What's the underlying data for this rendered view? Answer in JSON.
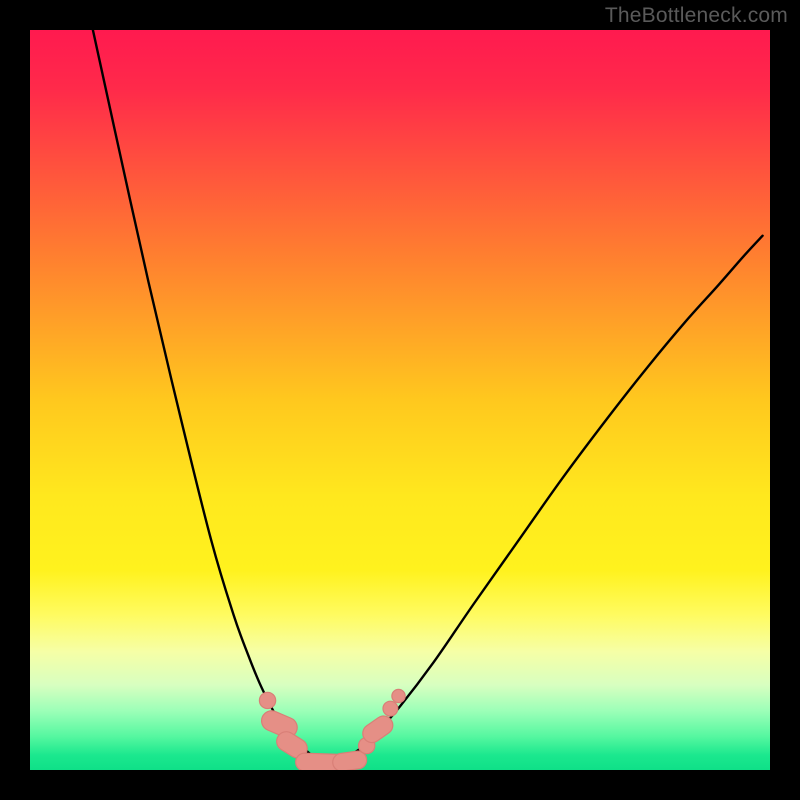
{
  "watermark": "TheBottleneck.com",
  "chart_data": {
    "type": "line",
    "title": "",
    "xlabel": "",
    "ylabel": "",
    "xlim": [
      0,
      1
    ],
    "ylim": [
      0,
      1
    ],
    "background_gradient_stops": [
      {
        "offset": 0.0,
        "color": "#ff1a4f"
      },
      {
        "offset": 0.08,
        "color": "#ff2a4a"
      },
      {
        "offset": 0.3,
        "color": "#ff7d30"
      },
      {
        "offset": 0.5,
        "color": "#ffc81e"
      },
      {
        "offset": 0.63,
        "color": "#ffe81e"
      },
      {
        "offset": 0.73,
        "color": "#fff21e"
      },
      {
        "offset": 0.79,
        "color": "#fffb60"
      },
      {
        "offset": 0.84,
        "color": "#f6ffa6"
      },
      {
        "offset": 0.885,
        "color": "#d8ffc0"
      },
      {
        "offset": 0.92,
        "color": "#9cffb8"
      },
      {
        "offset": 0.955,
        "color": "#55f7a0"
      },
      {
        "offset": 0.98,
        "color": "#1be88e"
      },
      {
        "offset": 1.0,
        "color": "#0fe088"
      }
    ],
    "series": [
      {
        "name": "left-arm",
        "x": [
          0.085,
          0.12,
          0.16,
          0.205,
          0.245,
          0.275,
          0.295,
          0.31,
          0.325,
          0.336,
          0.344,
          0.352,
          0.359,
          0.367,
          0.378,
          0.395
        ],
        "y": [
          1.0,
          0.84,
          0.66,
          0.47,
          0.31,
          0.21,
          0.155,
          0.118,
          0.087,
          0.067,
          0.055,
          0.046,
          0.039,
          0.032,
          0.022,
          0.008
        ]
      },
      {
        "name": "right-arm",
        "x": [
          0.395,
          0.42,
          0.445,
          0.47,
          0.5,
          0.545,
          0.6,
          0.66,
          0.72,
          0.78,
          0.835,
          0.885,
          0.93,
          0.965,
          0.99
        ],
        "y": [
          0.008,
          0.014,
          0.028,
          0.052,
          0.086,
          0.145,
          0.225,
          0.31,
          0.395,
          0.475,
          0.545,
          0.605,
          0.655,
          0.695,
          0.722
        ]
      }
    ],
    "markers": [
      {
        "shape": "circle",
        "cx": 0.321,
        "cy": 0.094,
        "r": 0.011
      },
      {
        "shape": "capsule",
        "cx": 0.337,
        "cy": 0.062,
        "w": 0.027,
        "h": 0.05,
        "angle": -67
      },
      {
        "shape": "capsule",
        "cx": 0.354,
        "cy": 0.034,
        "w": 0.026,
        "h": 0.044,
        "angle": -58
      },
      {
        "shape": "capsule",
        "cx": 0.392,
        "cy": 0.01,
        "w": 0.024,
        "h": 0.066,
        "angle": -88
      },
      {
        "shape": "capsule",
        "cx": 0.432,
        "cy": 0.012,
        "w": 0.024,
        "h": 0.046,
        "angle": 82
      },
      {
        "shape": "circle",
        "cx": 0.455,
        "cy": 0.033,
        "r": 0.011
      },
      {
        "shape": "capsule",
        "cx": 0.47,
        "cy": 0.055,
        "w": 0.025,
        "h": 0.044,
        "angle": 55
      },
      {
        "shape": "circle",
        "cx": 0.487,
        "cy": 0.083,
        "r": 0.01
      },
      {
        "shape": "circle",
        "cx": 0.498,
        "cy": 0.1,
        "r": 0.009
      }
    ],
    "marker_fill": "#e58f86",
    "marker_stroke": "#d97f77",
    "curve_stroke": "#000000",
    "curve_width": 2.4
  }
}
